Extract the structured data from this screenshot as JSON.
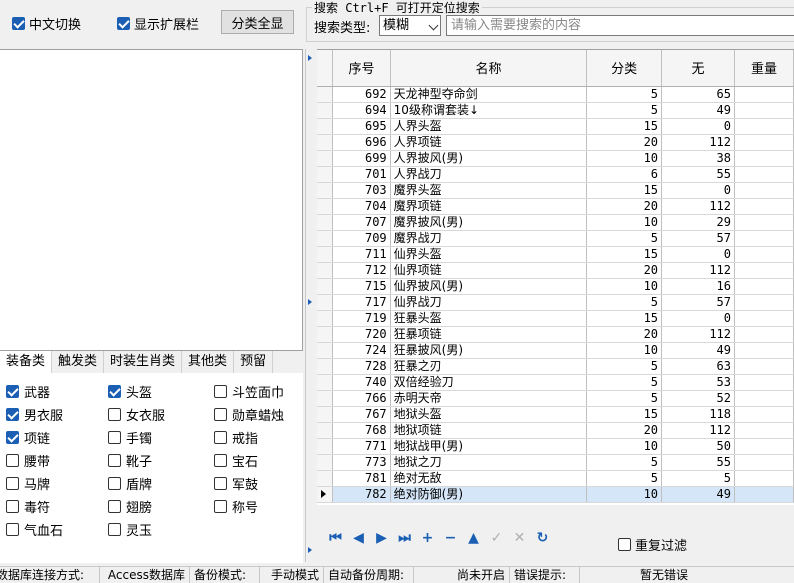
{
  "toolbar": {
    "chinese_switch": {
      "label": "中文切换",
      "checked": true
    },
    "show_ext": {
      "label": "显示扩展栏",
      "checked": true
    },
    "show_all_button": "分类全显"
  },
  "search": {
    "legend": "搜索   Ctrl+F 可打开定位搜索",
    "type_label": "搜索类型:",
    "type_value": "模糊",
    "placeholder": "请输入需要搜索的内容"
  },
  "category_tabs": [
    "装备类",
    "触发类",
    "时装生肖类",
    "其他类",
    "预留"
  ],
  "categories": [
    {
      "label": "武器",
      "checked": true
    },
    {
      "label": "头盔",
      "checked": true
    },
    {
      "label": "斗笠面巾",
      "checked": false
    },
    {
      "label": "男衣服",
      "checked": true
    },
    {
      "label": "女衣服",
      "checked": false
    },
    {
      "label": "勋章蜡烛",
      "checked": false
    },
    {
      "label": "项链",
      "checked": true
    },
    {
      "label": "手镯",
      "checked": false
    },
    {
      "label": "戒指",
      "checked": false
    },
    {
      "label": "腰带",
      "checked": false
    },
    {
      "label": "靴子",
      "checked": false
    },
    {
      "label": "宝石",
      "checked": false
    },
    {
      "label": "马牌",
      "checked": false
    },
    {
      "label": "盾牌",
      "checked": false
    },
    {
      "label": "军鼓",
      "checked": false
    },
    {
      "label": "毒符",
      "checked": false
    },
    {
      "label": "翅膀",
      "checked": false
    },
    {
      "label": "称号",
      "checked": false
    },
    {
      "label": "气血石",
      "checked": false
    },
    {
      "label": "灵玉",
      "checked": false
    }
  ],
  "grid": {
    "columns": [
      "序号",
      "名称",
      "分类",
      "无",
      "重量"
    ],
    "rows": [
      {
        "id": "692",
        "name": "天龙神型夺命剑",
        "cat": "5",
        "none": "65",
        "weight": ""
      },
      {
        "id": "694",
        "name": "10级称谓套装↓",
        "cat": "5",
        "none": "49",
        "weight": ""
      },
      {
        "id": "695",
        "name": "人界头盔",
        "cat": "15",
        "none": "0",
        "weight": ""
      },
      {
        "id": "696",
        "name": "人界项链",
        "cat": "20",
        "none": "112",
        "weight": ""
      },
      {
        "id": "699",
        "name": "人界披风(男)",
        "cat": "10",
        "none": "38",
        "weight": ""
      },
      {
        "id": "701",
        "name": "人界战刀",
        "cat": "6",
        "none": "55",
        "weight": ""
      },
      {
        "id": "703",
        "name": "魔界头盔",
        "cat": "15",
        "none": "0",
        "weight": ""
      },
      {
        "id": "704",
        "name": "魔界项链",
        "cat": "20",
        "none": "112",
        "weight": ""
      },
      {
        "id": "707",
        "name": "魔界披风(男)",
        "cat": "10",
        "none": "29",
        "weight": ""
      },
      {
        "id": "709",
        "name": "魔界战刀",
        "cat": "5",
        "none": "57",
        "weight": ""
      },
      {
        "id": "711",
        "name": "仙界头盔",
        "cat": "15",
        "none": "0",
        "weight": ""
      },
      {
        "id": "712",
        "name": "仙界项链",
        "cat": "20",
        "none": "112",
        "weight": ""
      },
      {
        "id": "715",
        "name": "仙界披风(男)",
        "cat": "10",
        "none": "16",
        "weight": ""
      },
      {
        "id": "717",
        "name": "仙界战刀",
        "cat": "5",
        "none": "57",
        "weight": ""
      },
      {
        "id": "719",
        "name": "狂暴头盔",
        "cat": "15",
        "none": "0",
        "weight": ""
      },
      {
        "id": "720",
        "name": "狂暴项链",
        "cat": "20",
        "none": "112",
        "weight": ""
      },
      {
        "id": "724",
        "name": "狂暴披风(男)",
        "cat": "10",
        "none": "49",
        "weight": ""
      },
      {
        "id": "728",
        "name": "狂暴之刃",
        "cat": "5",
        "none": "63",
        "weight": ""
      },
      {
        "id": "740",
        "name": "双倍经验刀",
        "cat": "5",
        "none": "53",
        "weight": ""
      },
      {
        "id": "766",
        "name": "赤明天帝",
        "cat": "5",
        "none": "52",
        "weight": ""
      },
      {
        "id": "767",
        "name": "地狱头盔",
        "cat": "15",
        "none": "118",
        "weight": ""
      },
      {
        "id": "768",
        "name": "地狱项链",
        "cat": "20",
        "none": "112",
        "weight": ""
      },
      {
        "id": "771",
        "name": "地狱战甲(男)",
        "cat": "10",
        "none": "50",
        "weight": ""
      },
      {
        "id": "773",
        "name": "地狱之刀",
        "cat": "5",
        "none": "55",
        "weight": ""
      },
      {
        "id": "781",
        "name": "绝对无敌",
        "cat": "5",
        "none": "5",
        "weight": ""
      },
      {
        "id": "782",
        "name": "绝对防御(男)",
        "cat": "10",
        "none": "49",
        "weight": "",
        "selected": true
      }
    ]
  },
  "navigator": [
    "first-record-icon",
    "prior-record-icon",
    "next-record-icon",
    "last-record-icon",
    "insert-record-icon",
    "delete-record-icon",
    "edit-record-icon",
    "post-record-icon",
    "cancel-record-icon",
    "refresh-record-icon"
  ],
  "dedupe": {
    "label": "重复过滤",
    "checked": false
  },
  "status": {
    "conn_label": "数据库连接方式:",
    "conn_value": "Access数据库",
    "backup_label": "备份模式:",
    "backup_value": "手动模式",
    "auto_label": "自动备份周期:",
    "auto_value": "尚未开启",
    "error_label": "错误提示:",
    "error_value": "暂无错误"
  },
  "colors": {
    "accent": "#1a5fb4",
    "selected_row": "#d4e6f7"
  }
}
